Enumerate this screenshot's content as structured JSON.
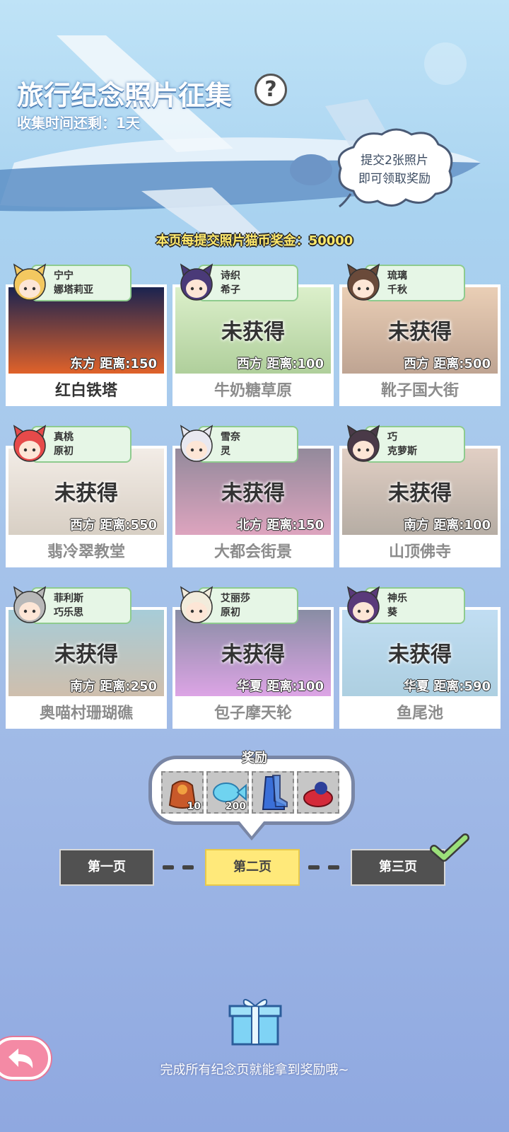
{
  "header": {
    "title": "旅行纪念照片征集",
    "help_icon": "?",
    "timer_label": "收集时间还剩：",
    "timer_value": "1天",
    "tip_line1": "提交2张照片",
    "tip_line2": "即可领取奖励",
    "bonus_text": "本页每提交照片猫币奖金：50000"
  },
  "cards": [
    {
      "char1": "宁宁",
      "char2": "娜塔莉亚",
      "status": "",
      "direction": "东方",
      "distance": "距离:150",
      "name": "红白铁塔",
      "obtained": true
    },
    {
      "char1": "诗织",
      "char2": "希子",
      "status": "未获得",
      "direction": "西方",
      "distance": "距离:100",
      "name": "牛奶糖草原",
      "obtained": false
    },
    {
      "char1": "琉璃",
      "char2": "千秋",
      "status": "未获得",
      "direction": "西方",
      "distance": "距离:500",
      "name": "靴子国大街",
      "obtained": false
    },
    {
      "char1": "真桃",
      "char2": "原初",
      "status": "未获得",
      "direction": "西方",
      "distance": "距离:550",
      "name": "翡冷翠教堂",
      "obtained": false
    },
    {
      "char1": "雪奈",
      "char2": "灵",
      "status": "未获得",
      "direction": "北方",
      "distance": "距离:150",
      "name": "大都会街景",
      "obtained": false
    },
    {
      "char1": "巧",
      "char2": "克萝斯",
      "status": "未获得",
      "direction": "南方",
      "distance": "距离:100",
      "name": "山顶佛寺",
      "obtained": false
    },
    {
      "char1": "菲利斯",
      "char2": "巧乐思",
      "status": "未获得",
      "direction": "南方",
      "distance": "距离:250",
      "name": "奥喵村珊瑚礁",
      "obtained": false
    },
    {
      "char1": "艾丽莎",
      "char2": "原初",
      "status": "未获得",
      "direction": "华夏",
      "distance": "距离:100",
      "name": "包子摩天轮",
      "obtained": false
    },
    {
      "char1": "神乐",
      "char2": "葵",
      "status": "未获得",
      "direction": "华夏",
      "distance": "距离:590",
      "name": "鱼尾池",
      "obtained": false
    }
  ],
  "reward": {
    "label": "奖励",
    "items": [
      {
        "icon": "food-bag-icon",
        "qty": "10"
      },
      {
        "icon": "blue-fish-icon",
        "qty": "200"
      },
      {
        "icon": "boots-icon",
        "qty": ""
      },
      {
        "icon": "red-hat-icon",
        "qty": ""
      }
    ]
  },
  "pages": {
    "page1": "第一页",
    "page2": "第二页",
    "page3": "第三页",
    "active": 2
  },
  "footer": {
    "hint": "完成所有纪念页就能拿到奖励哦~"
  },
  "colors": {
    "accent_yellow": "#ffe97a",
    "page_dark": "#515151",
    "char_bg": "#e6f6e6",
    "back_pink": "#f48aa5"
  }
}
